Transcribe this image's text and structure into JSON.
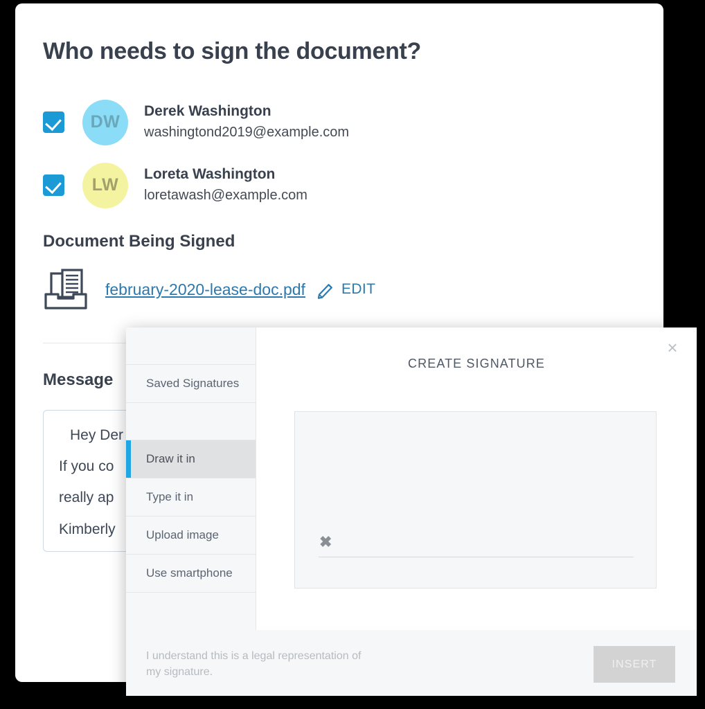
{
  "page": {
    "title": "Who needs to sign the document?"
  },
  "signers": [
    {
      "checked": true,
      "initials": "DW",
      "avatar_bg": "#8adcf7",
      "avatar_fg": "#6aa7ba",
      "name": "Derek Washington",
      "email": "washingtond2019@example.com"
    },
    {
      "checked": true,
      "initials": "LW",
      "avatar_bg": "#f4f4a0",
      "avatar_fg": "#a3a16a",
      "name": "Loreta Washington",
      "email": "loretawash@example.com"
    }
  ],
  "document": {
    "heading": "Document Being Signed",
    "filename": "february-2020-lease-doc.pdf",
    "edit_label": "EDIT"
  },
  "message": {
    "heading": "Message",
    "lines": [
      "Hey Der",
      "If you co",
      "really ap",
      "Kimberly"
    ]
  },
  "modal": {
    "title": "CREATE SIGNATURE",
    "close_label": "×",
    "sidebar": [
      {
        "label": "",
        "active": false,
        "spacer": true
      },
      {
        "label": "Saved Signatures",
        "active": false,
        "spacer": false
      },
      {
        "label": "",
        "active": false,
        "spacer": true
      },
      {
        "label": "Draw it in",
        "active": true,
        "spacer": false
      },
      {
        "label": "Type it in",
        "active": false,
        "spacer": false
      },
      {
        "label": "Upload image",
        "active": false,
        "spacer": false
      },
      {
        "label": "Use smartphone",
        "active": false,
        "spacer": false
      }
    ],
    "canvas": {
      "x_mark": "✖"
    },
    "legal_text": "I understand this is a legal representation of my signature.",
    "insert_label": "INSERT"
  },
  "colors": {
    "accent_blue": "#1b9ad6",
    "link_blue": "#2d78ad",
    "heading": "#39414f",
    "active_bar": "#20a6e3"
  }
}
